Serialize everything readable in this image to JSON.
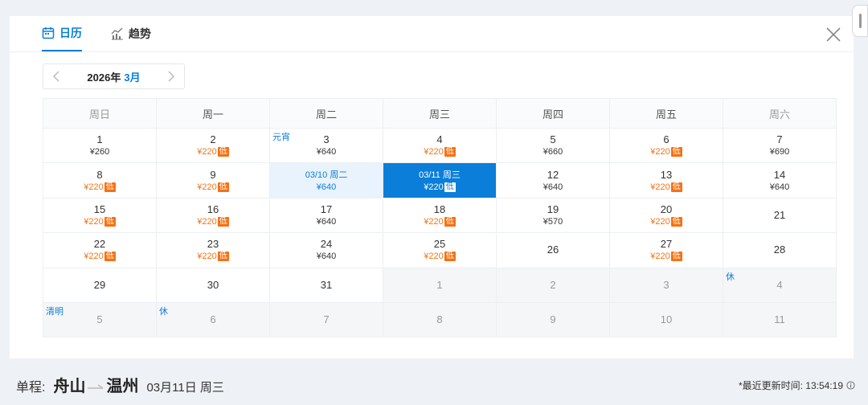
{
  "tabs": [
    {
      "label": "日历",
      "icon": "calendar-icon",
      "active": true
    },
    {
      "label": "趋势",
      "icon": "trend-chart-icon",
      "active": false
    }
  ],
  "month_nav": {
    "year": "2026年",
    "month": "3月"
  },
  "weekdays": [
    "周日",
    "周一",
    "周二",
    "周三",
    "周四",
    "周五",
    "周六"
  ],
  "low_tag": "低",
  "weeks": [
    [
      {
        "day": "1",
        "price": "¥260"
      },
      {
        "day": "2",
        "price": "¥220",
        "low": true
      },
      {
        "day": "3",
        "price": "¥640",
        "holiday": "元宵"
      },
      {
        "day": "4",
        "price": "¥220",
        "low": true
      },
      {
        "day": "5",
        "price": "¥660"
      },
      {
        "day": "6",
        "price": "¥220",
        "low": true
      },
      {
        "day": "7",
        "price": "¥690"
      }
    ],
    [
      {
        "day": "8",
        "price": "¥220",
        "low": true
      },
      {
        "day": "9",
        "price": "¥220",
        "low": true
      },
      {
        "day": "03/10 周二",
        "price": "¥640",
        "state": "range"
      },
      {
        "day": "03/11 周三",
        "price": "¥220",
        "low": true,
        "state": "selected"
      },
      {
        "day": "12",
        "price": "¥640"
      },
      {
        "day": "13",
        "price": "¥220",
        "low": true
      },
      {
        "day": "14",
        "price": "¥640"
      }
    ],
    [
      {
        "day": "15",
        "price": "¥220",
        "low": true
      },
      {
        "day": "16",
        "price": "¥220",
        "low": true
      },
      {
        "day": "17",
        "price": "¥640"
      },
      {
        "day": "18",
        "price": "¥220",
        "low": true
      },
      {
        "day": "19",
        "price": "¥570"
      },
      {
        "day": "20",
        "price": "¥220",
        "low": true
      },
      {
        "day": "21"
      }
    ],
    [
      {
        "day": "22",
        "price": "¥220",
        "low": true
      },
      {
        "day": "23",
        "price": "¥220",
        "low": true
      },
      {
        "day": "24",
        "price": "¥640"
      },
      {
        "day": "25",
        "price": "¥220",
        "low": true
      },
      {
        "day": "26"
      },
      {
        "day": "27",
        "price": "¥220",
        "low": true
      },
      {
        "day": "28"
      }
    ],
    [
      {
        "day": "29"
      },
      {
        "day": "30"
      },
      {
        "day": "31"
      },
      {
        "day": "1",
        "other": true
      },
      {
        "day": "2",
        "other": true
      },
      {
        "day": "3",
        "other": true
      },
      {
        "day": "4",
        "other": true,
        "holiday": "休"
      }
    ],
    [
      {
        "day": "5",
        "other": true,
        "holiday": "清明"
      },
      {
        "day": "6",
        "other": true,
        "holiday": "休"
      },
      {
        "day": "7",
        "other": true
      },
      {
        "day": "8",
        "other": true
      },
      {
        "day": "9",
        "other": true
      },
      {
        "day": "10",
        "other": true
      },
      {
        "day": "11",
        "other": true
      }
    ]
  ],
  "trip": {
    "label": "单程:",
    "from": "舟山",
    "to": "温州",
    "date": "03月11日 周三"
  },
  "update_text": "*最近更新时间: 13:54:19",
  "colors": {
    "accent": "#0a7ed9",
    "low_price": "#f47215"
  }
}
